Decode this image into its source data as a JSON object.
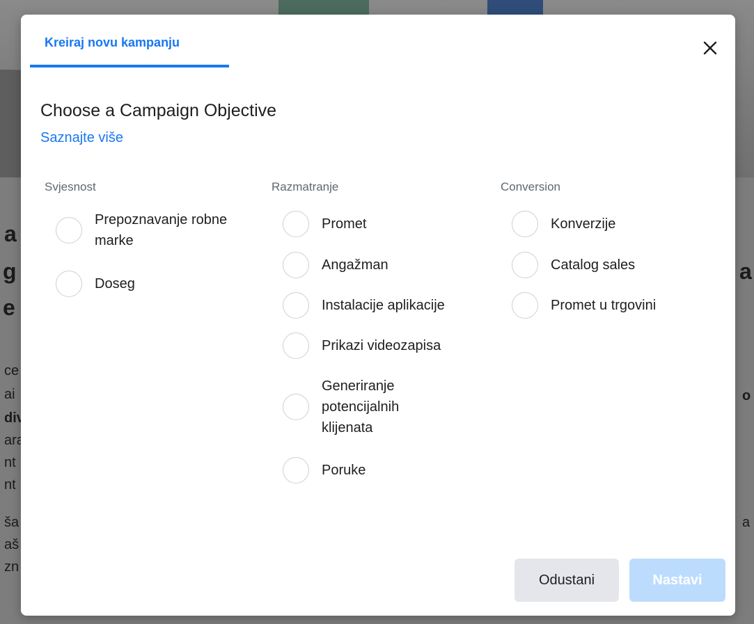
{
  "background": {
    "left_fragments": [
      "a",
      "g",
      "e",
      "ce",
      "ai",
      "div",
      "ara",
      "nt",
      "nt",
      "ša",
      "aš",
      "zn"
    ],
    "right_fragments": [
      "a",
      "o",
      "a"
    ]
  },
  "modal": {
    "tab_label": "Kreiraj novu kampanju",
    "close_icon": "close-icon",
    "heading": "Choose a Campaign Objective",
    "learn_more": "Saznajte više",
    "columns": [
      {
        "title": "Svjesnost",
        "options": [
          "Prepoznavanje robne marke",
          "Doseg"
        ]
      },
      {
        "title": "Razmatranje",
        "options": [
          "Promet",
          "Angažman",
          "Instalacije aplikacije",
          "Prikazi videozapisa",
          "Generiranje potencijalnih klijenata",
          "Poruke"
        ]
      },
      {
        "title": "Conversion",
        "options": [
          "Konverzije",
          "Catalog sales",
          "Promet u trgovini"
        ]
      }
    ],
    "cancel_label": "Odustani",
    "continue_label": "Nastavi"
  },
  "colors": {
    "accent": "#1877f2",
    "disabled_primary": "#bcdcfd",
    "secondary_button": "#e4e6eb"
  }
}
